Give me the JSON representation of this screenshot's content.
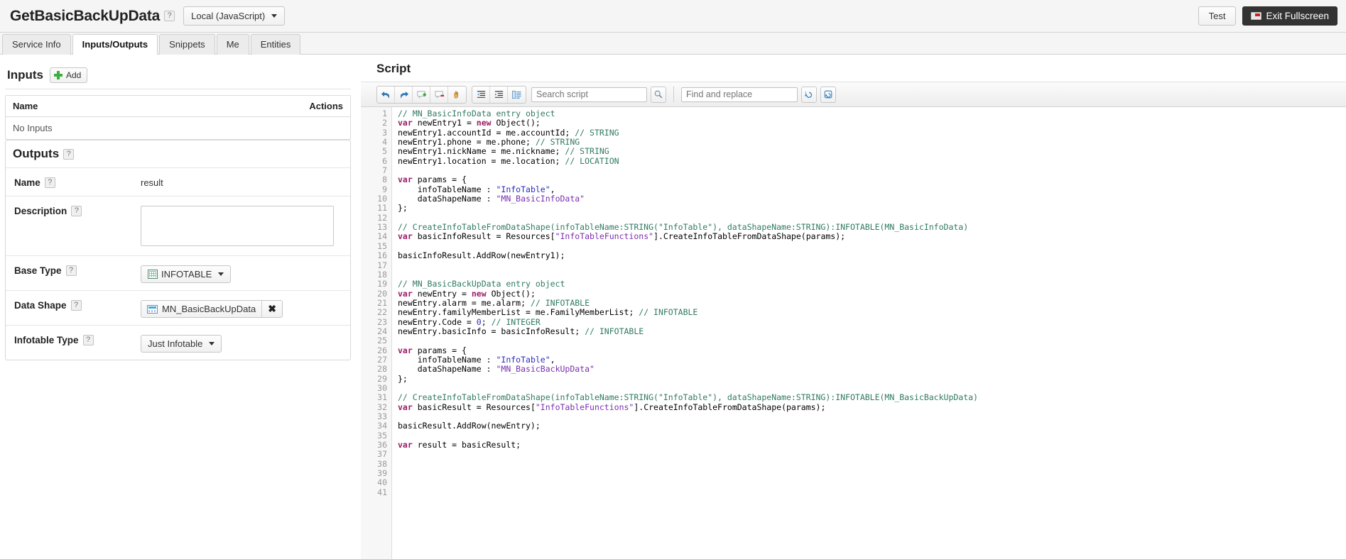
{
  "header": {
    "title": "GetBasicBackUpData",
    "help": "?",
    "handler": "Local (JavaScript)",
    "test_label": "Test",
    "exit_fullscreen_label": "Exit Fullscreen"
  },
  "tabs": [
    {
      "label": "Service Info",
      "active": false
    },
    {
      "label": "Inputs/Outputs",
      "active": true
    },
    {
      "label": "Snippets",
      "active": false
    },
    {
      "label": "Me",
      "active": false
    },
    {
      "label": "Entities",
      "active": false
    }
  ],
  "inputs": {
    "title": "Inputs",
    "add_label": "Add",
    "columns": [
      "Name",
      "Actions"
    ],
    "empty_text": "No Inputs"
  },
  "outputs": {
    "title": "Outputs",
    "help": "?",
    "rows": {
      "name": {
        "label": "Name",
        "help": "?",
        "value": "result"
      },
      "description": {
        "label": "Description",
        "help": "?",
        "value": "",
        "placeholder": ""
      },
      "base_type": {
        "label": "Base Type",
        "help": "?",
        "value": "INFOTABLE"
      },
      "data_shape": {
        "label": "Data Shape",
        "help": "?",
        "value": "MN_BasicBackUpData",
        "remove": "✖"
      },
      "infotable_type": {
        "label": "Infotable Type",
        "help": "?",
        "value": "Just Infotable"
      }
    }
  },
  "script": {
    "title": "Script",
    "toolbar": {
      "undo": "undo-icon",
      "redo": "redo-icon",
      "add_comment": "add-comment-icon",
      "remove_comment": "remove-comment-icon",
      "snippet": "hand-snippet-icon",
      "outdent": "outdent-icon",
      "indent": "indent-icon",
      "format": "format-code-icon",
      "search_placeholder": "Search script",
      "search_button": "search-icon",
      "find_replace_placeholder": "Find and replace",
      "replace_one_button": "replace-one-icon",
      "replace_all_button": "replace-all-icon"
    },
    "total_lines": 41,
    "lines": [
      {
        "n": 1,
        "tokens": [
          {
            "t": "cm",
            "s": "// MN_BasicInfoData entry object"
          }
        ]
      },
      {
        "n": 2,
        "tokens": [
          {
            "t": "kw",
            "s": "var"
          },
          {
            "t": "",
            "s": " newEntry1 = "
          },
          {
            "t": "kw",
            "s": "new"
          },
          {
            "t": "",
            "s": " Object();"
          }
        ]
      },
      {
        "n": 3,
        "tokens": [
          {
            "t": "",
            "s": "newEntry1.accountId = me.accountId; "
          },
          {
            "t": "cm",
            "s": "// STRING"
          }
        ]
      },
      {
        "n": 4,
        "tokens": [
          {
            "t": "",
            "s": "newEntry1.phone = me.phone; "
          },
          {
            "t": "cm",
            "s": "// STRING"
          }
        ]
      },
      {
        "n": 5,
        "tokens": [
          {
            "t": "",
            "s": "newEntry1.nickName = me.nickname; "
          },
          {
            "t": "cm",
            "s": "// STRING"
          }
        ]
      },
      {
        "n": 6,
        "tokens": [
          {
            "t": "",
            "s": "newEntry1.location = me.location; "
          },
          {
            "t": "cm",
            "s": "// LOCATION"
          }
        ]
      },
      {
        "n": 7,
        "tokens": []
      },
      {
        "n": 8,
        "tokens": [
          {
            "t": "kw",
            "s": "var"
          },
          {
            "t": "",
            "s": " params = {"
          }
        ]
      },
      {
        "n": 9,
        "tokens": [
          {
            "t": "",
            "s": "    infoTableName : "
          },
          {
            "t": "str",
            "s": "\"InfoTable\""
          },
          {
            "t": "",
            "s": ","
          }
        ]
      },
      {
        "n": 10,
        "tokens": [
          {
            "t": "",
            "s": "    dataShapeName : "
          },
          {
            "t": "strp",
            "s": "\"MN_BasicInfoData\""
          }
        ]
      },
      {
        "n": 11,
        "tokens": [
          {
            "t": "",
            "s": "};"
          }
        ]
      },
      {
        "n": 12,
        "tokens": []
      },
      {
        "n": 13,
        "tokens": [
          {
            "t": "cm",
            "s": "// CreateInfoTableFromDataShape(infoTableName:STRING(\"InfoTable\"), dataShapeName:STRING):INFOTABLE(MN_BasicInfoData)"
          }
        ]
      },
      {
        "n": 14,
        "tokens": [
          {
            "t": "kw",
            "s": "var"
          },
          {
            "t": "",
            "s": " basicInfoResult = Resources["
          },
          {
            "t": "strp",
            "s": "\"InfoTableFunctions\""
          },
          {
            "t": "",
            "s": "].CreateInfoTableFromDataShape(params);"
          }
        ]
      },
      {
        "n": 15,
        "tokens": []
      },
      {
        "n": 16,
        "tokens": [
          {
            "t": "",
            "s": "basicInfoResult.AddRow(newEntry1);"
          }
        ]
      },
      {
        "n": 17,
        "tokens": []
      },
      {
        "n": 18,
        "tokens": []
      },
      {
        "n": 19,
        "tokens": [
          {
            "t": "cm",
            "s": "// MN_BasicBackUpData entry object"
          }
        ]
      },
      {
        "n": 20,
        "tokens": [
          {
            "t": "kw",
            "s": "var"
          },
          {
            "t": "",
            "s": " newEntry = "
          },
          {
            "t": "kw",
            "s": "new"
          },
          {
            "t": "",
            "s": " Object();"
          }
        ]
      },
      {
        "n": 21,
        "tokens": [
          {
            "t": "",
            "s": "newEntry.alarm = me.alarm; "
          },
          {
            "t": "cm",
            "s": "// INFOTABLE"
          }
        ]
      },
      {
        "n": 22,
        "tokens": [
          {
            "t": "",
            "s": "newEntry.familyMemberList = me.FamilyMemberList; "
          },
          {
            "t": "cm",
            "s": "// INFOTABLE"
          }
        ]
      },
      {
        "n": 23,
        "tokens": [
          {
            "t": "",
            "s": "newEntry.Code = "
          },
          {
            "t": "num",
            "s": "0"
          },
          {
            "t": "",
            "s": "; "
          },
          {
            "t": "cm",
            "s": "// INTEGER"
          }
        ]
      },
      {
        "n": 24,
        "tokens": [
          {
            "t": "",
            "s": "newEntry.basicInfo = basicInfoResult; "
          },
          {
            "t": "cm",
            "s": "// INFOTABLE"
          }
        ]
      },
      {
        "n": 25,
        "tokens": []
      },
      {
        "n": 26,
        "tokens": [
          {
            "t": "kw",
            "s": "var"
          },
          {
            "t": "",
            "s": " params = {"
          }
        ]
      },
      {
        "n": 27,
        "tokens": [
          {
            "t": "",
            "s": "    infoTableName : "
          },
          {
            "t": "str",
            "s": "\"InfoTable\""
          },
          {
            "t": "",
            "s": ","
          }
        ]
      },
      {
        "n": 28,
        "tokens": [
          {
            "t": "",
            "s": "    dataShapeName : "
          },
          {
            "t": "strp",
            "s": "\"MN_BasicBackUpData\""
          }
        ]
      },
      {
        "n": 29,
        "tokens": [
          {
            "t": "",
            "s": "};"
          }
        ]
      },
      {
        "n": 30,
        "tokens": []
      },
      {
        "n": 31,
        "tokens": [
          {
            "t": "cm",
            "s": "// CreateInfoTableFromDataShape(infoTableName:STRING(\"InfoTable\"), dataShapeName:STRING):INFOTABLE(MN_BasicBackUpData)"
          }
        ]
      },
      {
        "n": 32,
        "tokens": [
          {
            "t": "kw",
            "s": "var"
          },
          {
            "t": "",
            "s": " basicResult = Resources["
          },
          {
            "t": "strp",
            "s": "\"InfoTableFunctions\""
          },
          {
            "t": "",
            "s": "].CreateInfoTableFromDataShape(params);"
          }
        ]
      },
      {
        "n": 33,
        "tokens": []
      },
      {
        "n": 34,
        "tokens": [
          {
            "t": "",
            "s": "basicResult.AddRow(newEntry);"
          }
        ]
      },
      {
        "n": 35,
        "tokens": []
      },
      {
        "n": 36,
        "tokens": [
          {
            "t": "kw",
            "s": "var"
          },
          {
            "t": "",
            "s": " result = basicResult;"
          }
        ]
      },
      {
        "n": 37,
        "tokens": []
      },
      {
        "n": 38,
        "tokens": []
      },
      {
        "n": 39,
        "tokens": []
      },
      {
        "n": 40,
        "tokens": []
      },
      {
        "n": 41,
        "tokens": []
      }
    ]
  },
  "colors": {
    "comment": "#2f7a62",
    "keyword": "#9b1b68",
    "string": "#2b2bbf",
    "string_alt": "#7a2fb0",
    "accent_dark": "#333333",
    "add_green": "#3fae3f"
  }
}
